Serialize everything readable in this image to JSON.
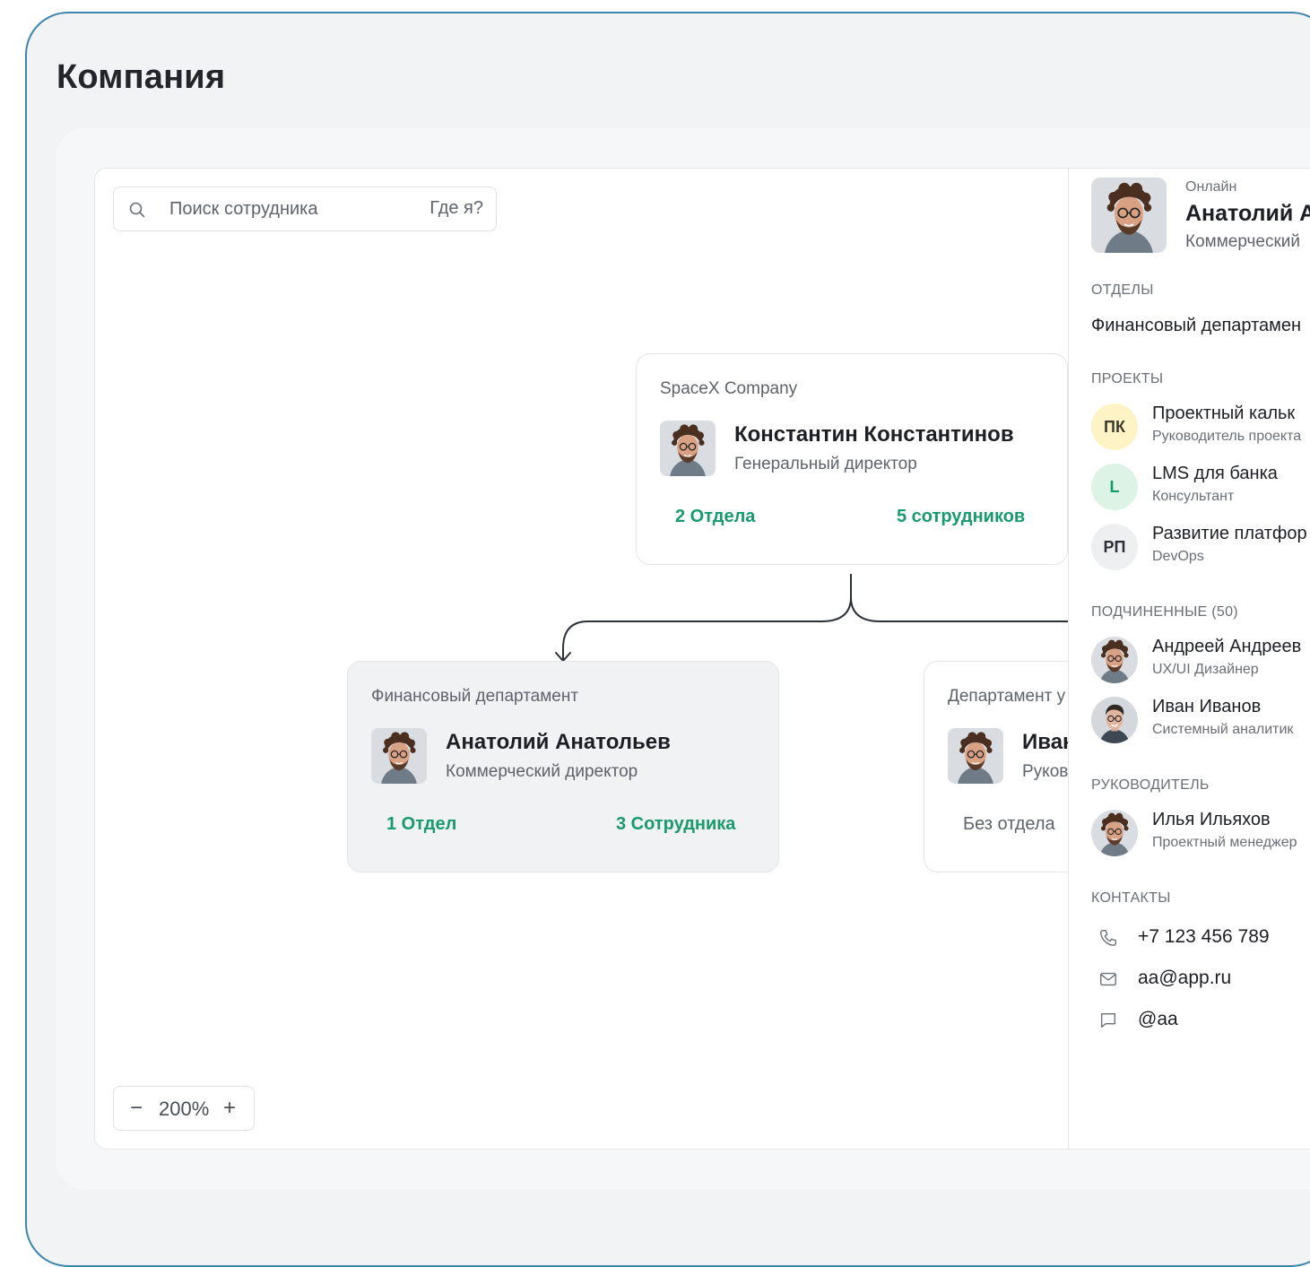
{
  "page": {
    "title": "Компания"
  },
  "search": {
    "placeholder": "Поиск сотрудника",
    "where_label": "Где я?"
  },
  "zoom": {
    "minus": "−",
    "value": "200%",
    "plus": "+"
  },
  "nodes": {
    "ceo": {
      "company": "SpaceX Company",
      "name": "Константин Константинов",
      "role": "Генеральный директор",
      "departments": "2 Отдела",
      "employees": "5 сотрудников"
    },
    "finance": {
      "company": "Финансовый департамент",
      "name": "Анатолий Анатольев",
      "role": "Коммерческий директор",
      "departments": "1 Отдел",
      "employees": "3 Сотрудника"
    },
    "dept2": {
      "company": "Департамент у",
      "name": "Иван",
      "role": "Руков",
      "departments": "Без отдела"
    }
  },
  "panel": {
    "status": "Онлайн",
    "name": "Анатолий А",
    "role": "Коммерческий",
    "departments_label": "Отделы",
    "department": "Финансовый департамен",
    "projects_label": "Проекты",
    "projects": [
      {
        "initials": "ПК",
        "title": "Проектный кальк",
        "role": "Руководитель проекта",
        "bg": "#fdf3c4",
        "fg": "#3c3a2e"
      },
      {
        "initials": "L",
        "title": "LMS для банка",
        "role": "Консультант",
        "bg": "#dcf3e6",
        "fg": "#189a6d"
      },
      {
        "initials": "РП",
        "title": "Развитие платфор",
        "role": "DevOps",
        "bg": "#eeeff1",
        "fg": "#2c2f35"
      }
    ],
    "subordinates_label": "Подчиненные (50)",
    "subordinates": [
      {
        "name": "Андреей Андреев",
        "role": "UX/UI Дизайнер"
      },
      {
        "name": "Иван Иванов",
        "role": "Системный аналитик"
      }
    ],
    "manager_label": "Руководитель",
    "manager": {
      "name": "Илья Ильяхов",
      "role": "Проектный менеджер"
    },
    "contacts_label": "Контакты",
    "contacts": {
      "phone": "+7 123 456 789",
      "email": "aa@app.ru",
      "chat": "@aa"
    }
  },
  "colors": {
    "accent_green": "#189a6d",
    "frame_border": "#3f86ad",
    "page_bg": "#f2f3f5"
  }
}
